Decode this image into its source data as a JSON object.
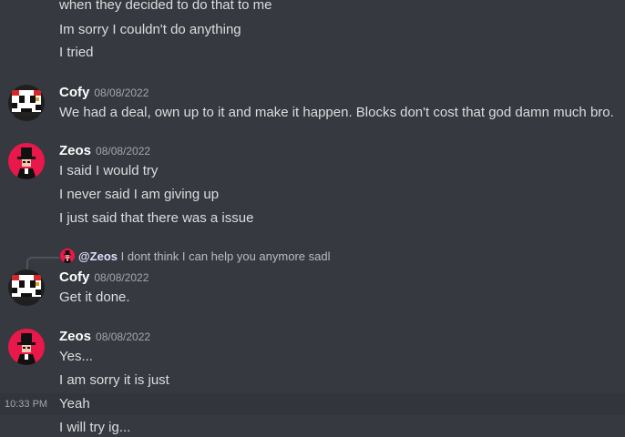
{
  "colors": {
    "background": "#36393f",
    "hover_row": "#32353b",
    "text": "#dcddde",
    "muted": "#a3a6aa",
    "zeos_avatar_bg": "#e8184a"
  },
  "top_lines": [
    "when they decided to do that to me",
    "Im sorry I couldn't do anything",
    "I tried"
  ],
  "groups": [
    {
      "author": "Cofy",
      "timestamp": "08/08/2022",
      "avatar_icon": "pixel-avatar-icon",
      "lines": [
        "We had a deal, own up to it and make it happen. Blocks don't cost that god damn much bro."
      ]
    },
    {
      "author": "Zeos",
      "timestamp": "08/08/2022",
      "avatar_icon": "top-hat-avatar-icon",
      "lines": [
        "I said I would try",
        "I never said I am giving up",
        "I just said that there was a issue"
      ]
    },
    {
      "author": "Cofy",
      "timestamp": "08/08/2022",
      "avatar_icon": "pixel-avatar-icon",
      "reply": {
        "mention": "@Zeos",
        "text": "I dont think I can help you anymore sadl"
      },
      "lines": [
        "Get it done."
      ]
    },
    {
      "author": "Zeos",
      "timestamp": "08/08/2022",
      "avatar_icon": "top-hat-avatar-icon",
      "lines": [
        "Yes...",
        "I am sorry it is just",
        "Yeah",
        "I will try ig..."
      ]
    }
  ],
  "hover_time": "10:33 PM"
}
